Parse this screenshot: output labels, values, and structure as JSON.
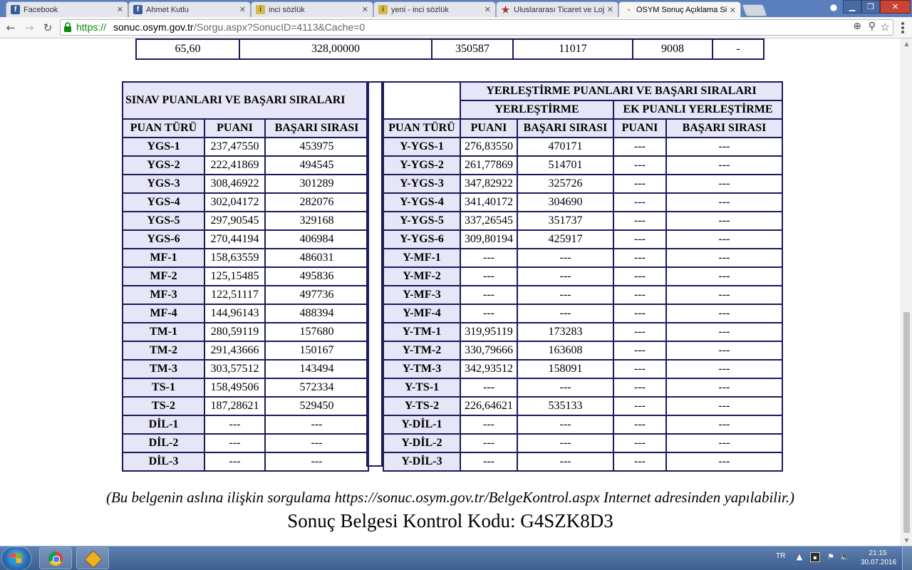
{
  "browser": {
    "tabs": [
      {
        "title": "Facebook",
        "favicon": "facebook-icon",
        "active": false
      },
      {
        "title": "Ahmet Kutlu",
        "favicon": "facebook-icon",
        "active": false
      },
      {
        "title": "inci sözlük",
        "favicon": "inci-icon",
        "active": false
      },
      {
        "title": "yeni - inci sözlük",
        "favicon": "inci-icon",
        "active": false
      },
      {
        "title": "Uluslararası Ticaret ve Loj",
        "favicon": "star-icon",
        "active": false
      },
      {
        "title": "ÖSYM Sonuç Açıklama Sis",
        "favicon": "osym-icon",
        "active": true
      }
    ],
    "url_scheme": "https://",
    "url_domain": "sonuc.osym.gov.tr",
    "url_path": "/Sorgu.aspx?SonucID=4113&Cache=0"
  },
  "top_row": [
    "65,60",
    "328,00000",
    "350587",
    "11017",
    "9008",
    "-"
  ],
  "sinav": {
    "title": "SINAV PUANLARI VE BAŞARI SIRALARI",
    "headers": [
      "PUAN TÜRÜ",
      "PUANI",
      "BAŞARI SIRASI"
    ],
    "rows": [
      [
        "YGS-1",
        "237,47550",
        "453975"
      ],
      [
        "YGS-2",
        "222,41869",
        "494545"
      ],
      [
        "YGS-3",
        "308,46922",
        "301289"
      ],
      [
        "YGS-4",
        "302,04172",
        "282076"
      ],
      [
        "YGS-5",
        "297,90545",
        "329168"
      ],
      [
        "YGS-6",
        "270,44194",
        "406984"
      ],
      [
        "MF-1",
        "158,63559",
        "486031"
      ],
      [
        "MF-2",
        "125,15485",
        "495836"
      ],
      [
        "MF-3",
        "122,51117",
        "497736"
      ],
      [
        "MF-4",
        "144,96143",
        "488394"
      ],
      [
        "TM-1",
        "280,59119",
        "157680"
      ],
      [
        "TM-2",
        "291,43666",
        "150167"
      ],
      [
        "TM-3",
        "303,57512",
        "143494"
      ],
      [
        "TS-1",
        "158,49506",
        "572334"
      ],
      [
        "TS-2",
        "187,28621",
        "529450"
      ],
      [
        "DİL-1",
        "---",
        "---"
      ],
      [
        "DİL-2",
        "---",
        "---"
      ],
      [
        "DİL-3",
        "---",
        "---"
      ]
    ]
  },
  "yerlestirme": {
    "title": "YERLEŞTİRME PUANLARI VE BAŞARI SIRALARI",
    "sub1": "YERLEŞTİRME",
    "sub2": "EK PUANLI YERLEŞTİRME",
    "headers": [
      "PUAN TÜRÜ",
      "PUANI",
      "BAŞARI SIRASI",
      "PUANI",
      "BAŞARI SIRASI"
    ],
    "rows": [
      [
        "Y-YGS-1",
        "276,83550",
        "470171",
        "---",
        "---"
      ],
      [
        "Y-YGS-2",
        "261,77869",
        "514701",
        "---",
        "---"
      ],
      [
        "Y-YGS-3",
        "347,82922",
        "325726",
        "---",
        "---"
      ],
      [
        "Y-YGS-4",
        "341,40172",
        "304690",
        "---",
        "---"
      ],
      [
        "Y-YGS-5",
        "337,26545",
        "351737",
        "---",
        "---"
      ],
      [
        "Y-YGS-6",
        "309,80194",
        "425917",
        "---",
        "---"
      ],
      [
        "Y-MF-1",
        "---",
        "---",
        "---",
        "---"
      ],
      [
        "Y-MF-2",
        "---",
        "---",
        "---",
        "---"
      ],
      [
        "Y-MF-3",
        "---",
        "---",
        "---",
        "---"
      ],
      [
        "Y-MF-4",
        "---",
        "---",
        "---",
        "---"
      ],
      [
        "Y-TM-1",
        "319,95119",
        "173283",
        "---",
        "---"
      ],
      [
        "Y-TM-2",
        "330,79666",
        "163608",
        "---",
        "---"
      ],
      [
        "Y-TM-3",
        "342,93512",
        "158091",
        "---",
        "---"
      ],
      [
        "Y-TS-1",
        "---",
        "---",
        "---",
        "---"
      ],
      [
        "Y-TS-2",
        "226,64621",
        "535133",
        "---",
        "---"
      ],
      [
        "Y-DİL-1",
        "---",
        "---",
        "---",
        "---"
      ],
      [
        "Y-DİL-2",
        "---",
        "---",
        "---",
        "---"
      ],
      [
        "Y-DİL-3",
        "---",
        "---",
        "---",
        "---"
      ]
    ]
  },
  "footer": {
    "note": "(Bu belgenin aslına ilişkin sorgulama https://sonuc.osym.gov.tr/BelgeKontrol.aspx Internet adresinden yapılabilir.)",
    "control_code": "Sonuç Belgesi Kontrol Kodu: G4SZK8D3"
  },
  "taskbar": {
    "language": "TR",
    "time": "21:15",
    "date": "30.07.2016",
    "apps": [
      "chrome-icon",
      "winamp-icon"
    ]
  }
}
